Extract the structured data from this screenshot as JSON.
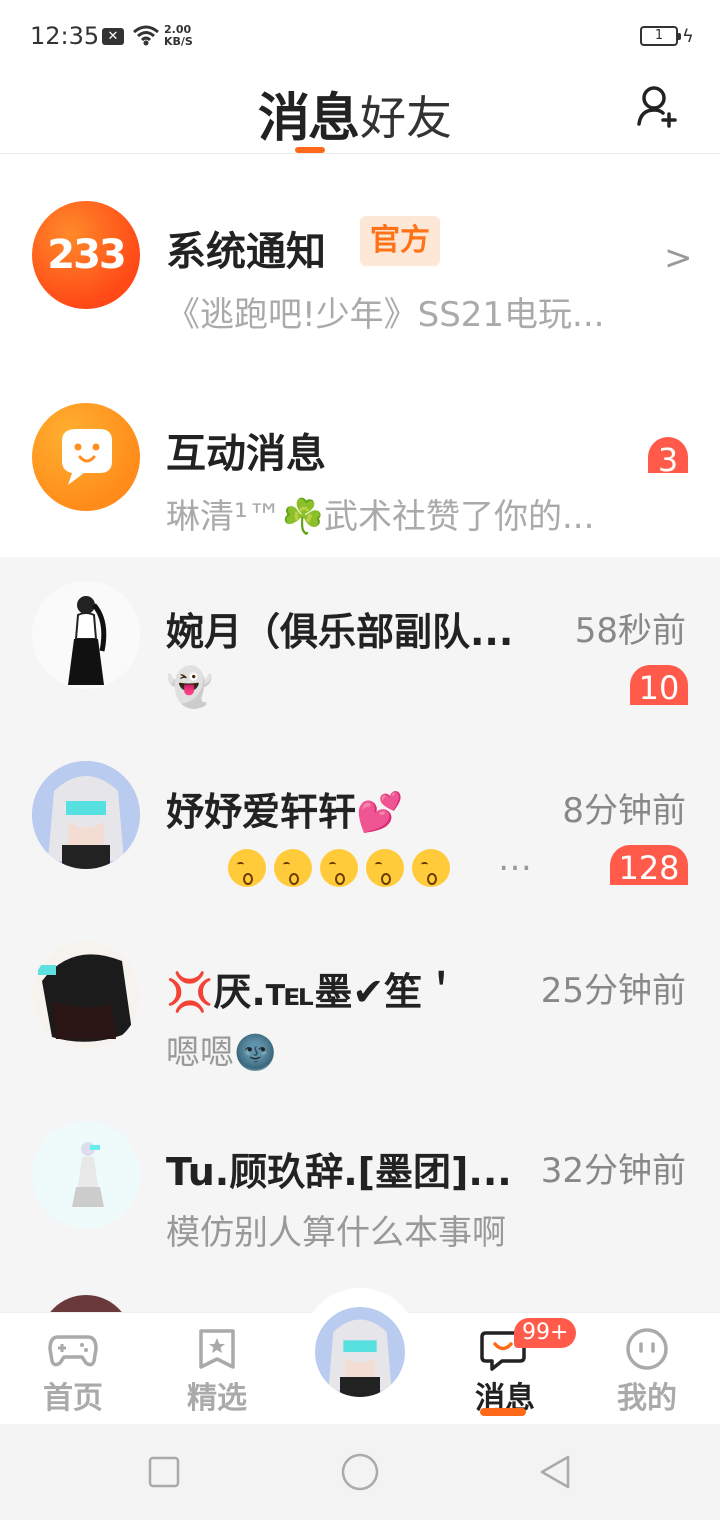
{
  "status_bar": {
    "time": "12:35",
    "network_speed": "2.00\nKB/S",
    "battery": "1"
  },
  "header": {
    "tab_messages": "消息",
    "tab_friends": "好友",
    "add_friend_icon": "person-add-icon"
  },
  "system_rows": [
    {
      "avatar_text": "233",
      "title": "系统通知",
      "badge": "官方",
      "subtitle": "《逃跑吧!少年》SS21电玩...",
      "icon": "chevron-right-icon"
    },
    {
      "title": "互动消息",
      "subtitle": "琳清¹™☘️武术社赞了你的...",
      "unread": "3",
      "icon": "chat-bubble-face-icon"
    }
  ],
  "chats": [
    {
      "name": "婉月（俱乐部副队...",
      "time": "58秒前",
      "message": "👻",
      "unread": "10"
    },
    {
      "name": "妤妤爱轩轩💕",
      "time": "8分钟前",
      "message": "…",
      "unread": "128"
    },
    {
      "name": "💢厌.℡墨✔笙＇",
      "time": "25分钟前",
      "message": "嗯嗯🌚",
      "unread": ""
    },
    {
      "name": "Tu.顾玖辞.[墨团]...",
      "time": "32分钟前",
      "message": "模仿别人算什么本事啊",
      "unread": ""
    }
  ],
  "bottom_nav": {
    "items": [
      {
        "label": "首页",
        "icon": "gamepad-icon"
      },
      {
        "label": "精选",
        "icon": "star-bookmark-icon"
      },
      {
        "label": "消息",
        "icon": "message-bubble-icon",
        "active": true,
        "badge": "99+"
      },
      {
        "label": "我的",
        "icon": "face-icon"
      }
    ]
  },
  "colors": {
    "accent": "#ff6a1a",
    "unread_red": "#ff5a4a",
    "list_bg": "#f5f5f5"
  }
}
